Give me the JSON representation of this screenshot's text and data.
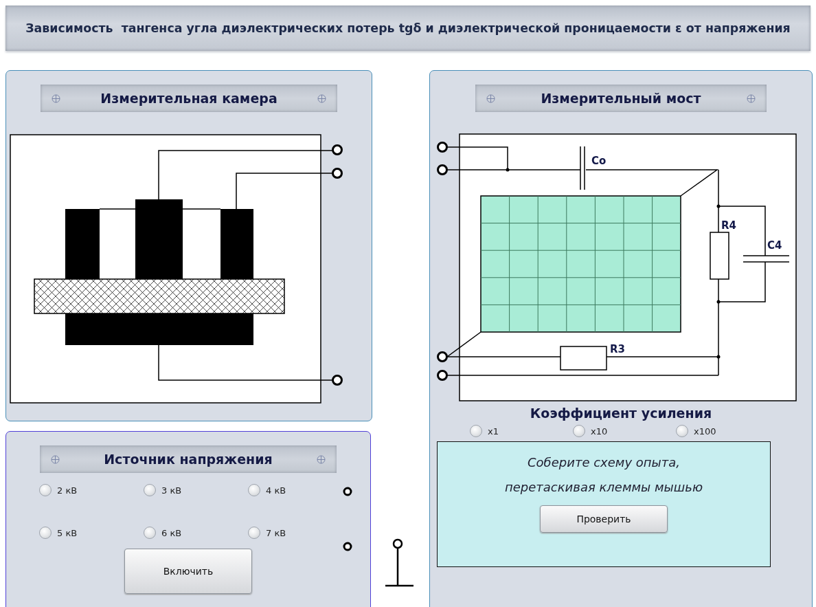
{
  "title": "Зависимость  тангенса угла диэлектрических потерь tgδ и диэлектрической проницаемости ε от напряжения",
  "camera": {
    "title": "Измерительная камера"
  },
  "bridge": {
    "title": "Измерительный мост",
    "labels": [
      "Co",
      "R4",
      "C4",
      "R3"
    ]
  },
  "gain": {
    "title": "Коэффициент усиления",
    "options": [
      {
        "label": "x1",
        "selected": false
      },
      {
        "label": "x10",
        "selected": false
      },
      {
        "label": "x100",
        "selected": false
      }
    ]
  },
  "message": {
    "lines": [
      "Соберите схему опыта,",
      "перетаскивая клеммы мышью"
    ],
    "button": "Проверить"
  },
  "source": {
    "title": "Источник напряжения",
    "options": [
      {
        "label": "2 кВ",
        "selected": false
      },
      {
        "label": "3 кВ",
        "selected": false
      },
      {
        "label": "4 кВ",
        "selected": false
      },
      {
        "label": "5 кВ",
        "selected": false
      },
      {
        "label": "6 кВ",
        "selected": false
      },
      {
        "label": "7 кВ",
        "selected": false
      }
    ],
    "button": "Включить"
  }
}
